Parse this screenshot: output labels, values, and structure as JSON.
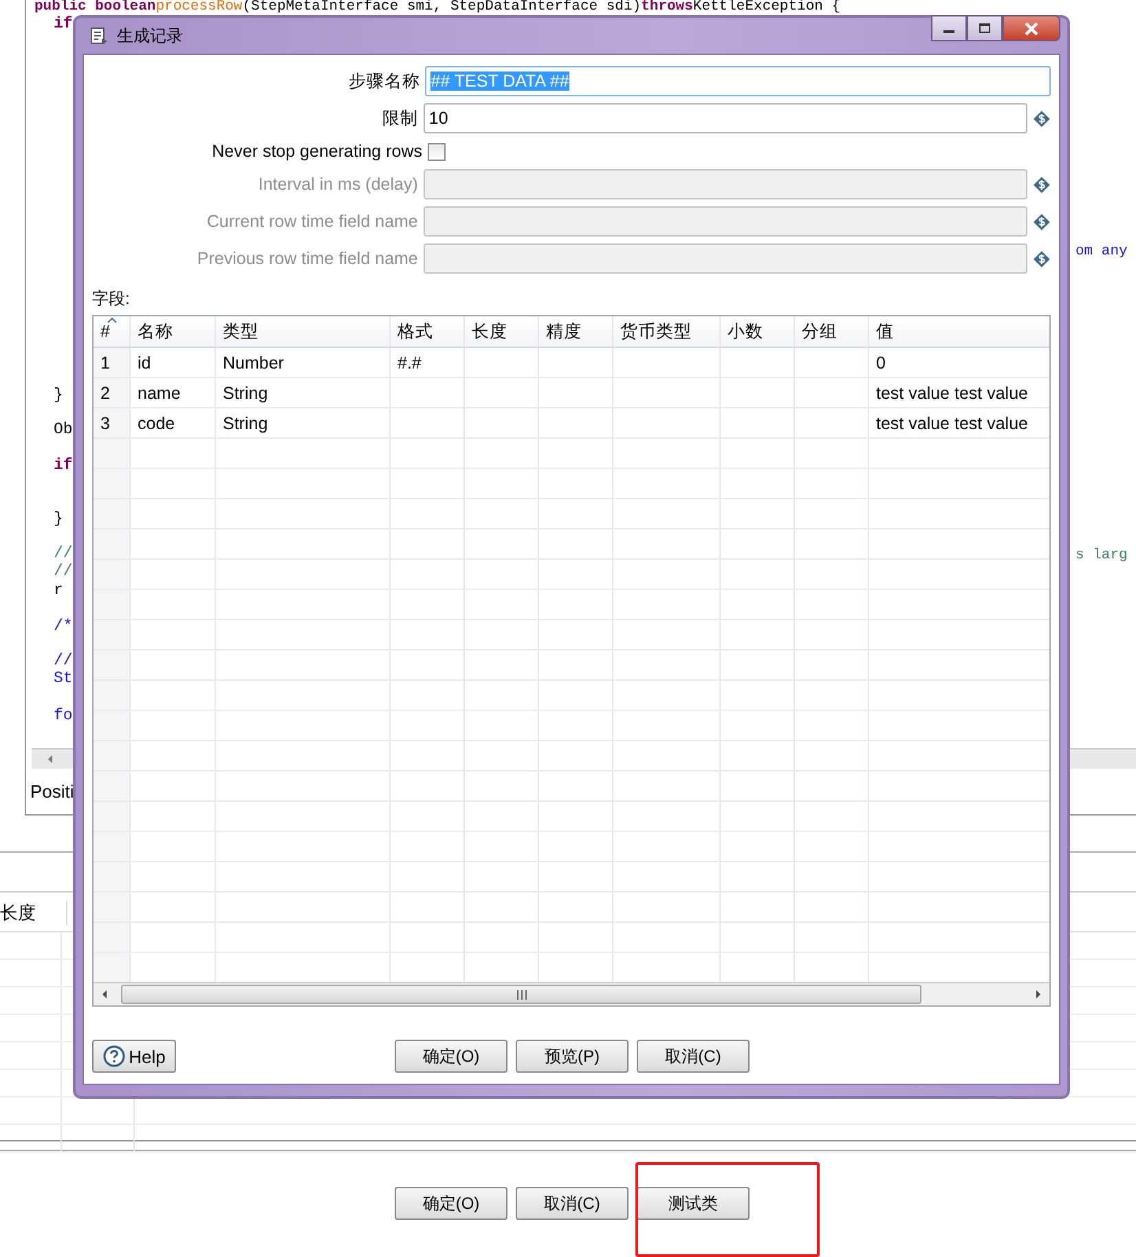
{
  "editor": {
    "top_line": [
      {
        "kind": "keyword",
        "text": "public boolean"
      },
      {
        "kind": "method",
        "text": "processRow"
      },
      {
        "kind": "plain",
        "text": "(StepMetaInterface smi, StepDataInterface sdi)"
      },
      {
        "kind": "keyword",
        "text": "throws"
      },
      {
        "kind": "plain",
        "text": "KettleException {"
      }
    ],
    "left_fragments": [
      {
        "kind": "keyword",
        "text": "if"
      },
      {
        "kind": "plain",
        "text": "}"
      },
      {
        "kind": "plain",
        "text": "Ob"
      },
      {
        "kind": "keyword",
        "text": "if"
      },
      {
        "kind": "plain",
        "text": "}"
      },
      {
        "kind": "comment",
        "text": "//"
      },
      {
        "kind": "comment",
        "text": "//"
      },
      {
        "kind": "plain",
        "text": "r"
      },
      {
        "kind": "doc",
        "text": "/*"
      },
      {
        "kind": "doc",
        "text": "//"
      },
      {
        "kind": "doc",
        "text": "St"
      },
      {
        "kind": "doc",
        "text": "fo"
      }
    ],
    "right_fragments": [
      {
        "kind": "doc",
        "text": "om any"
      },
      {
        "kind": "comment",
        "text": "s larg"
      }
    ],
    "status_text": "Positi"
  },
  "background_table": {
    "columns": [
      "长度"
    ]
  },
  "background_buttons": [
    {
      "label": "确定(O)"
    },
    {
      "label": "取消(C)"
    },
    {
      "label": "测试类"
    }
  ],
  "dialog": {
    "title": "生成记录",
    "fields": [
      {
        "kind": "text",
        "label": "步骤名称",
        "value": "## TEST DATA ##",
        "disabled": false,
        "focused": true,
        "text_selected": true,
        "variable": false
      },
      {
        "kind": "text",
        "label": "限制",
        "value": "10",
        "disabled": false,
        "focused": false,
        "text_selected": false,
        "variable": true
      },
      {
        "kind": "checkbox",
        "label": "Never stop generating rows",
        "checked": false
      },
      {
        "kind": "text",
        "label": "Interval in ms (delay)",
        "disabled": true,
        "focused": false,
        "variable": true
      },
      {
        "kind": "text",
        "label": "Current row time field name",
        "disabled": true,
        "focused": false,
        "variable": true
      },
      {
        "kind": "text",
        "label": "Previous row time field name",
        "disabled": true,
        "focused": false,
        "variable": true
      }
    ],
    "fields_label": "字段:",
    "table": {
      "columns": [
        "#",
        "名称",
        "类型",
        "格式",
        "长度",
        "精度",
        "货币类型",
        "小数",
        "分组",
        "值"
      ],
      "rows": [
        {
          "index": "1",
          "name": "id",
          "type": "Number",
          "format": "#.#",
          "value": "0"
        },
        {
          "index": "2",
          "name": "name",
          "type": "String",
          "value": "test value test value"
        },
        {
          "index": "3",
          "name": "code",
          "type": "String",
          "value": "test value test value"
        }
      ]
    },
    "help_button": "Help",
    "buttons": [
      {
        "label": "确定(O)"
      },
      {
        "label": "预览(P)"
      },
      {
        "label": "取消(C)"
      }
    ]
  }
}
